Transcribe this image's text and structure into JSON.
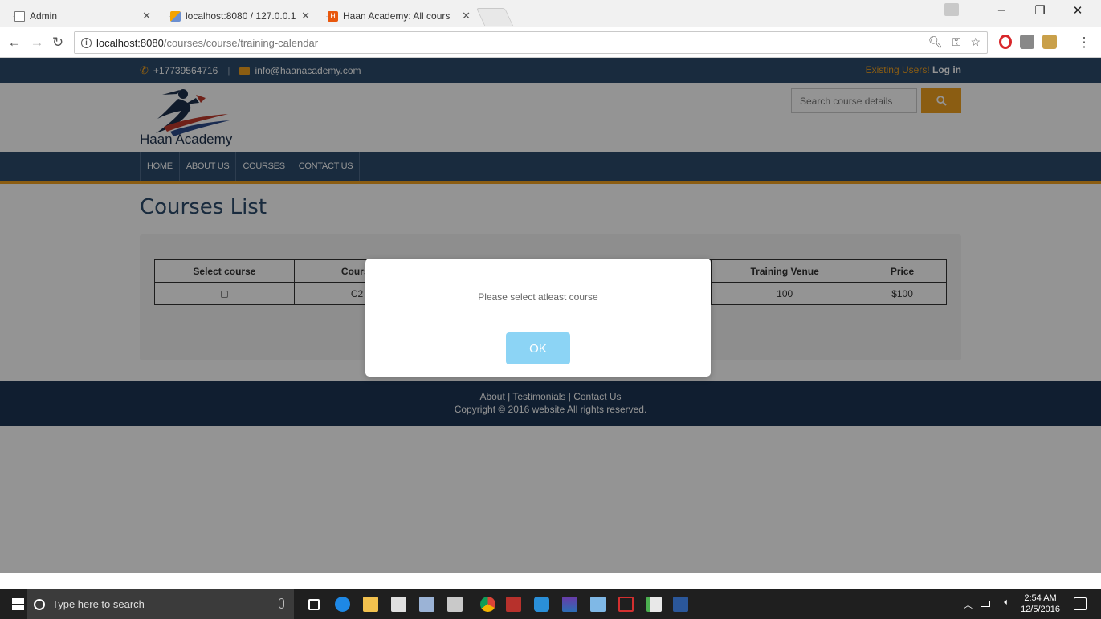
{
  "browser": {
    "tabs": [
      {
        "title": "Admin",
        "favicon": "page-icon",
        "active": false
      },
      {
        "title": "localhost:8080 / 127.0.0.1",
        "favicon": "phpmyadmin-icon",
        "active": false
      },
      {
        "title": "Haan Academy: All cours",
        "favicon": "haan-favicon",
        "active": true
      }
    ],
    "url_host": "localhost:8080",
    "url_path": "/courses/course/training-calendar"
  },
  "site": {
    "phone": "+17739564716",
    "email": "info@haanacademy.com",
    "login_prefix": "Existing Users!",
    "login_link": "Log in",
    "logo_text": "Haan Academy",
    "search_placeholder": "Search course details",
    "menu": [
      "HOME",
      "ABOUT US",
      "COURSES",
      "CONTACT US"
    ]
  },
  "main": {
    "title": "Courses List",
    "table": {
      "headers": [
        "Select course",
        "Cours",
        "Training Venue",
        "Price"
      ],
      "rows": [
        {
          "course": "C2",
          "venue": "100",
          "price": "$100"
        }
      ]
    }
  },
  "footer": {
    "links": "About | Testimonials | Contact Us",
    "copyright": "Copyright © 2016 website All rights reserved."
  },
  "modal": {
    "message": "Please select atleast course",
    "ok_label": "OK"
  },
  "taskbar": {
    "search_placeholder": "Type here to search",
    "time": "2:54 AM",
    "date": "12/5/2016"
  }
}
